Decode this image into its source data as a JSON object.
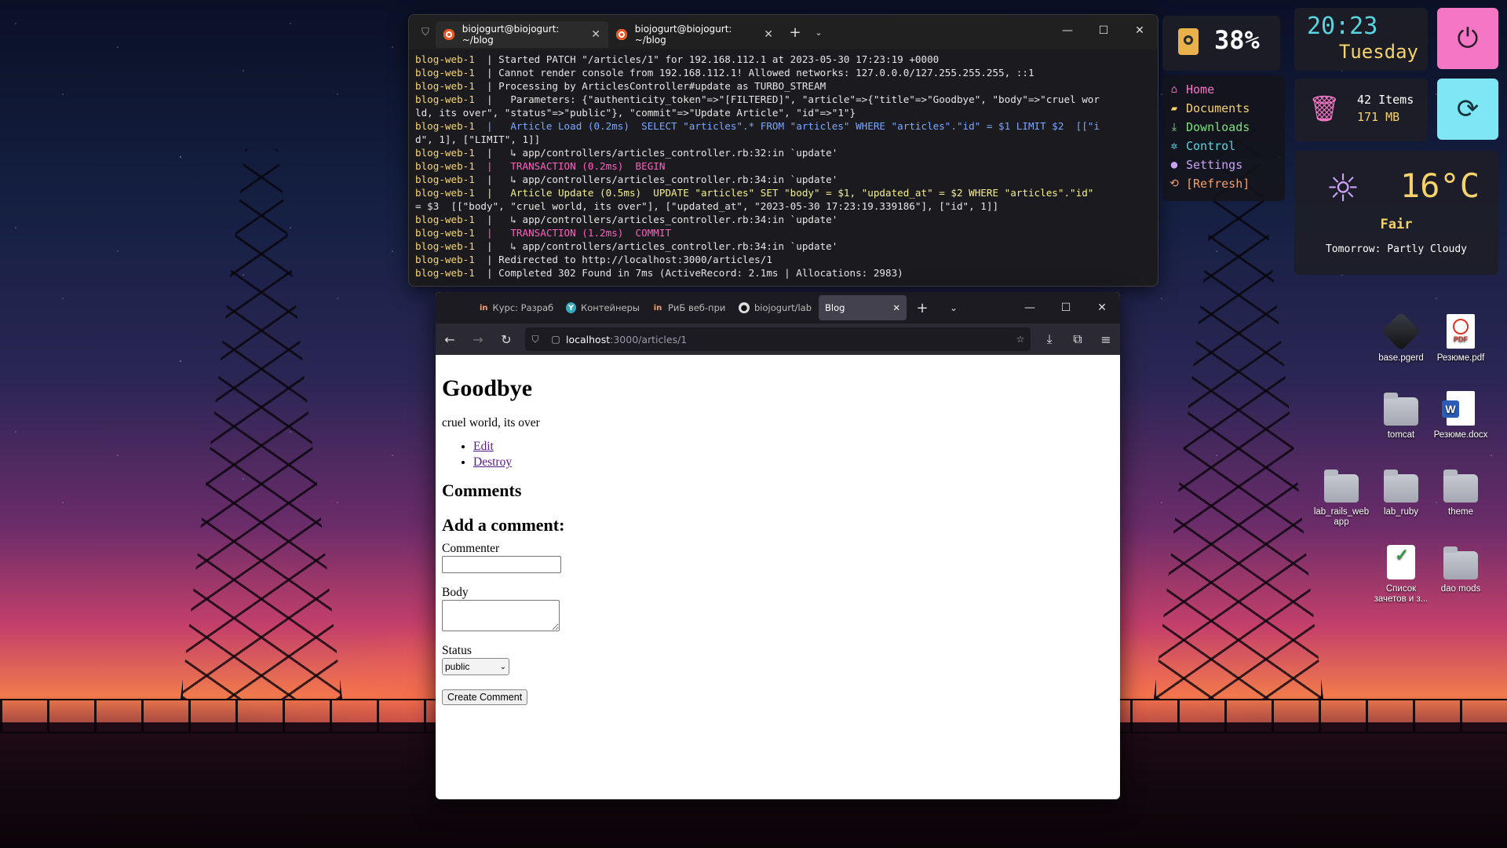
{
  "terminal": {
    "tabs": [
      {
        "title": "biojogurt@biojogurt: ~/blog",
        "active": true
      },
      {
        "title": "biojogurt@biojogurt: ~/blog",
        "active": false
      }
    ],
    "new_tab_label": "+",
    "lines": [
      {
        "prefix": "blog-web-1",
        "text": "  | Started PATCH \"/articles/1\" for 192.168.112.1 at 2023-05-30 17:23:19 +0000",
        "style": ""
      },
      {
        "prefix": "blog-web-1",
        "text": "  | Cannot render console from 192.168.112.1! Allowed networks: 127.0.0.0/127.255.255.255, ::1",
        "style": ""
      },
      {
        "prefix": "blog-web-1",
        "text": "  | Processing by ArticlesController#update as TURBO_STREAM",
        "style": ""
      },
      {
        "prefix": "blog-web-1",
        "text": "  |   Parameters: {\"authenticity_token\"=>\"[FILTERED]\", \"article\"=>{\"title\"=>\"Goodbye\", \"body\"=>\"cruel wor",
        "style": ""
      },
      {
        "prefix": "",
        "text": "ld, its over\", \"status\"=>\"public\"}, \"commit\"=>\"Update Article\", \"id\"=>\"1\"}",
        "style": ""
      },
      {
        "prefix": "blog-web-1",
        "text": "  |   Article Load (0.2ms)  SELECT \"articles\".* FROM \"articles\" WHERE \"articles\".\"id\" = $1 LIMIT $2  [[\"i",
        "style": "blue"
      },
      {
        "prefix": "",
        "text": "d\", 1], [\"LIMIT\", 1]]",
        "style": ""
      },
      {
        "prefix": "blog-web-1",
        "text": "  |   ↳ app/controllers/articles_controller.rb:32:in `update'",
        "style": ""
      },
      {
        "prefix": "blog-web-1",
        "text": "  |   TRANSACTION (0.2ms)  BEGIN",
        "style": "pink"
      },
      {
        "prefix": "blog-web-1",
        "text": "  |   ↳ app/controllers/articles_controller.rb:34:in `update'",
        "style": ""
      },
      {
        "prefix": "blog-web-1",
        "text": "  |   Article Update (0.5ms)  UPDATE \"articles\" SET \"body\" = $1, \"updated_at\" = $2 WHERE \"articles\".\"id\"",
        "style": "yellow"
      },
      {
        "prefix": "",
        "text": "= $3  [[\"body\", \"cruel world, its over\"], [\"updated_at\", \"2023-05-30 17:23:19.339186\"], [\"id\", 1]]",
        "style": ""
      },
      {
        "prefix": "blog-web-1",
        "text": "  |   ↳ app/controllers/articles_controller.rb:34:in `update'",
        "style": ""
      },
      {
        "prefix": "blog-web-1",
        "text": "  |   TRANSACTION (1.2ms)  COMMIT",
        "style": "pink"
      },
      {
        "prefix": "blog-web-1",
        "text": "  |   ↳ app/controllers/articles_controller.rb:34:in `update'",
        "style": ""
      },
      {
        "prefix": "blog-web-1",
        "text": "  | Redirected to http://localhost:3000/articles/1",
        "style": ""
      },
      {
        "prefix": "blog-web-1",
        "text": "  | Completed 302 Found in 7ms (ActiveRecord: 2.1ms | Allocations: 2983)",
        "style": ""
      }
    ]
  },
  "browser": {
    "tabs": [
      {
        "title": "Курс: Разраб",
        "favicon": "in",
        "active": false
      },
      {
        "title": "Контейнеры",
        "favicon": "Y",
        "active": false
      },
      {
        "title": "РиБ веб-при",
        "favicon": "in",
        "active": false
      },
      {
        "title": "biojogurt/lab",
        "favicon": "github",
        "active": false
      },
      {
        "title": "Blog",
        "favicon": "",
        "active": true
      }
    ],
    "url_host": "localhost",
    "url_rest": ":3000/articles/1",
    "page": {
      "title": "Goodbye",
      "body": "cruel world, its over",
      "links": [
        "Edit",
        "Destroy"
      ],
      "comments_heading": "Comments",
      "add_comment_heading": "Add a comment:",
      "commenter_label": "Commenter",
      "commenter_value": "",
      "body_label": "Body",
      "body_value": "",
      "status_label": "Status",
      "status_selected": "public",
      "submit_label": "Create Comment"
    }
  },
  "widgets": {
    "battery_percent": "38%",
    "menu": [
      {
        "label": "Home",
        "icon": "home-icon",
        "color": "#f476c4"
      },
      {
        "label": "Documents",
        "icon": "folder-icon",
        "color": "#f5d36a"
      },
      {
        "label": "Downloads",
        "icon": "download-icon",
        "color": "#7ae07a"
      },
      {
        "label": "Control",
        "icon": "gear-icon",
        "color": "#57d6e0"
      },
      {
        "label": "Settings",
        "icon": "drop-icon",
        "color": "#c9a1f5"
      },
      {
        "label": "[Refresh]",
        "icon": "refresh-icon",
        "color": "#f5a06a"
      }
    ],
    "clock_time": "20:23",
    "clock_day": "Tuesday",
    "trash_items": "42 Items",
    "trash_size": "171 MB",
    "weather_temp": "16°C",
    "weather_condition": "Fair",
    "weather_tomorrow": "Tomorrow: Partly Cloudy"
  },
  "desktop_icons": [
    {
      "label": "base.pgerd",
      "type": "gem"
    },
    {
      "label": "Резюме.pdf",
      "type": "pdf"
    },
    {
      "label": "tomcat",
      "type": "folder"
    },
    {
      "label": "Резюме.docx",
      "type": "word"
    },
    {
      "label": "lab_rails_web app",
      "type": "folder"
    },
    {
      "label": "lab_ruby",
      "type": "folder"
    },
    {
      "label": "theme",
      "type": "folder"
    },
    {
      "label": "Список зачетов и з...",
      "type": "xls"
    },
    {
      "label": "dao mods",
      "type": "folder"
    }
  ]
}
